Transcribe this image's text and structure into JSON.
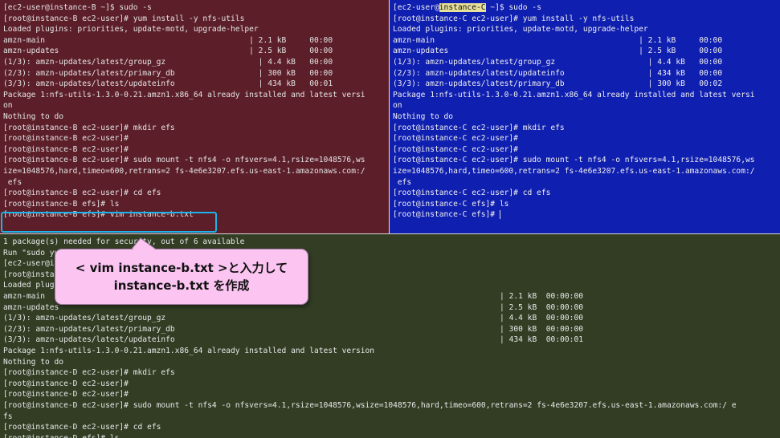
{
  "pane_b": {
    "lines": [
      "[ec2-user@instance-B ~]$ sudo -s",
      "[root@instance-B ec2-user]# yum install -y nfs-utils",
      "Loaded plugins: priorities, update-motd, upgrade-helper",
      "amzn-main                                            | 2.1 kB     00:00",
      "amzn-updates                                         | 2.5 kB     00:00",
      "(1/3): amzn-updates/latest/group_gz                    | 4.4 kB   00:00",
      "(2/3): amzn-updates/latest/primary_db                  | 300 kB   00:00",
      "(3/3): amzn-updates/latest/updateinfo                  | 434 kB   00:01",
      "Package 1:nfs-utils-1.3.0-0.21.amzn1.x86_64 already installed and latest versi",
      "on",
      "Nothing to do",
      "[root@instance-B ec2-user]# mkdir efs",
      "[root@instance-B ec2-user]#",
      "[root@instance-B ec2-user]#",
      "[root@instance-B ec2-user]# sudo mount -t nfs4 -o nfsvers=4.1,rsize=1048576,ws",
      "ize=1048576,hard,timeo=600,retrans=2 fs-4e6e3207.efs.us-east-1.amazonaws.com:/",
      " efs",
      "[root@instance-B ec2-user]# cd efs",
      "[root@instance-B efs]# ls",
      "[root@instance-B efs]# vim instance-b.txt"
    ]
  },
  "pane_c": {
    "first_line_prefix": "[ec2-user@",
    "first_line_highlight": "instance-C",
    "first_line_suffix": " ~]$ sudo -s",
    "lines": [
      "[root@instance-C ec2-user]# yum install -y nfs-utils",
      "Loaded plugins: priorities, update-motd, upgrade-helper",
      "amzn-main                                            | 2.1 kB     00:00",
      "amzn-updates                                         | 2.5 kB     00:00",
      "(1/3): amzn-updates/latest/group_gz                    | 4.4 kB   00:00",
      "(2/3): amzn-updates/latest/updateinfo                  | 434 kB   00:00",
      "(3/3): amzn-updates/latest/primary_db                  | 300 kB   00:02",
      "Package 1:nfs-utils-1.3.0-0.21.amzn1.x86_64 already installed and latest versi",
      "on",
      "Nothing to do",
      "[root@instance-C ec2-user]# mkdir efs",
      "[root@instance-C ec2-user]#",
      "[root@instance-C ec2-user]#",
      "[root@instance-C ec2-user]# sudo mount -t nfs4 -o nfsvers=4.1,rsize=1048576,ws",
      "ize=1048576,hard,timeo=600,retrans=2 fs-4e6e3207.efs.us-east-1.amazonaws.com:/",
      " efs",
      "[root@instance-C ec2-user]# cd efs",
      "[root@instance-C efs]# ls"
    ],
    "prompt_line": "[root@instance-C efs]# "
  },
  "pane_d": {
    "lines": [
      "1 package(s) needed for security, out of 6 available",
      "Run \"sudo yum update\" to apply all updates.",
      "[ec2-user@instance-D ~]$ sudo -s",
      "[root@instance-D ec2-user]# yum install -y nfs-utils",
      "Loaded plugins: priorities, update-motd, upgrade-helper",
      "amzn-main                                                                                                  | 2.1 kB  00:00:00",
      "amzn-updates                                                                                               | 2.5 kB  00:00:00",
      "(1/3): amzn-updates/latest/group_gz                                                                        | 4.4 kB  00:00:00",
      "(2/3): amzn-updates/latest/primary_db                                                                      | 300 kB  00:00:00",
      "(3/3): amzn-updates/latest/updateinfo                                                                      | 434 kB  00:00:01",
      "Package 1:nfs-utils-1.3.0-0.21.amzn1.x86_64 already installed and latest version",
      "Nothing to do",
      "[root@instance-D ec2-user]# mkdir efs",
      "[root@instance-D ec2-user]#",
      "[root@instance-D ec2-user]#",
      "[root@instance-D ec2-user]# sudo mount -t nfs4 -o nfsvers=4.1,rsize=1048576,wsize=1048576,hard,timeo=600,retrans=2 fs-4e6e3207.efs.us-east-1.amazonaws.com:/ e",
      "fs",
      "[root@instance-D ec2-user]# cd efs",
      "[root@instance-D efs]# ls"
    ]
  },
  "callout": {
    "line1": "< vim instance-b.txt >と入力して",
    "line2": "instance-b.txt を作成"
  },
  "colors": {
    "pane_b_bg": "#5c1f29",
    "pane_c_bg": "#0f1fb0",
    "pane_d_bg": "#323d24",
    "callout_bg": "#fbc4f1",
    "focus_border": "#1ab4e8",
    "highlight": "#e7e09a"
  }
}
